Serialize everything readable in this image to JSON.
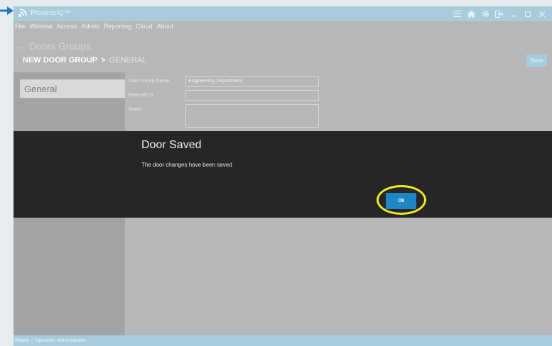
{
  "app": {
    "title": "ProxessIQ™"
  },
  "menu": [
    "File",
    "Window",
    "Access",
    "Admin",
    "Reporting",
    "Cloud",
    "About"
  ],
  "header": {
    "back_title": "← Doors Groups",
    "breadcrumb_1": "NEW DOOR GROUP",
    "breadcrumb_sep": ">",
    "breadcrumb_2": "GENERAL",
    "save_label": "Save"
  },
  "sidebar": {
    "items": [
      {
        "label": "General"
      }
    ]
  },
  "form": {
    "group_name_label": "Door Group Name:",
    "group_name_value": "Engineering Department",
    "external_id_label": "External ID:",
    "external_id_value": "",
    "notes_label": "Notes:",
    "notes_value": ""
  },
  "modal": {
    "title": "Door Saved",
    "message": "The door changes have been saved",
    "ok_label": "Ok"
  },
  "status": {
    "state": "Ready",
    "operator": "Operator: Administrator"
  },
  "colors": {
    "titlebar": "#a9ccdc",
    "modal_bg": "#262626",
    "ok_button": "#1c87c4",
    "highlight": "#f2ea24",
    "gutter_arrow": "#1b78c3"
  }
}
